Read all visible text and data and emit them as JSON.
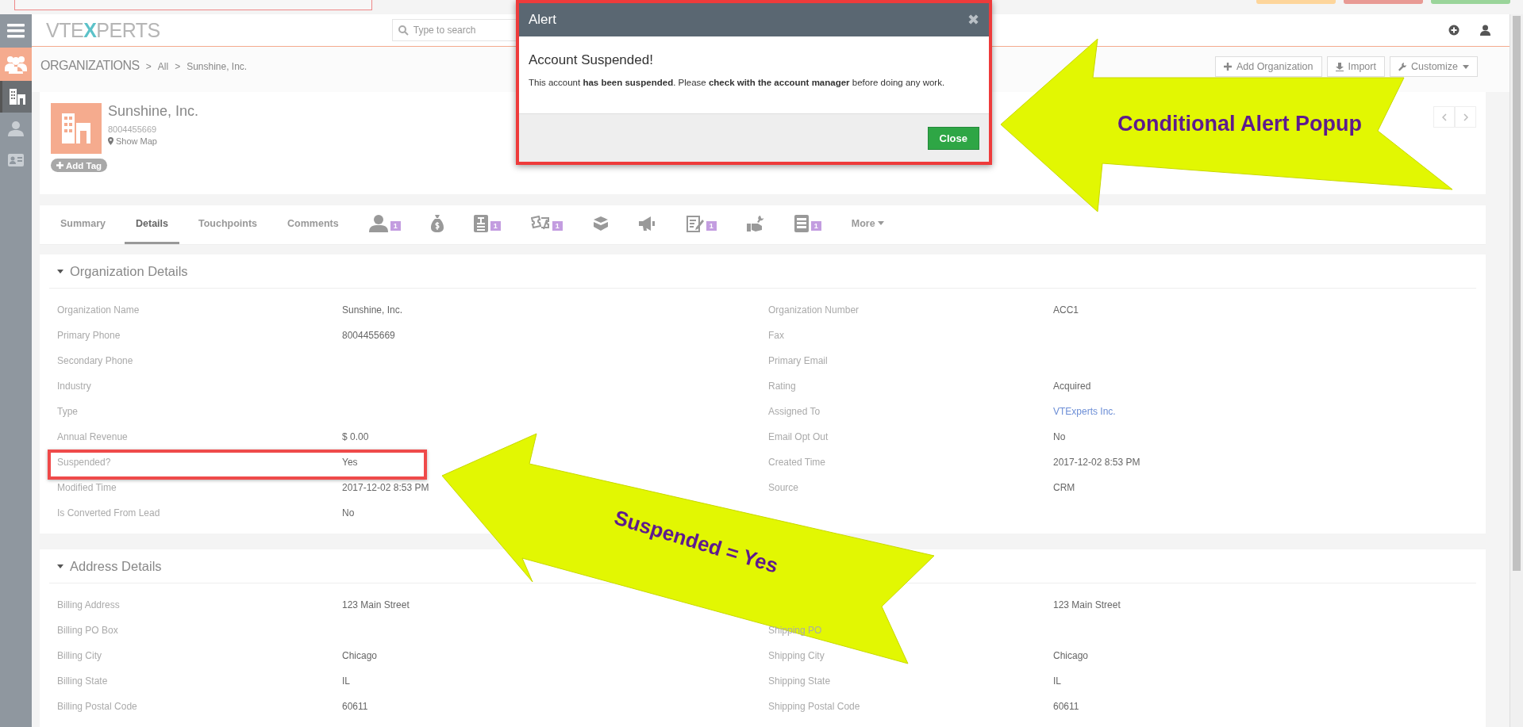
{
  "sidebar": {
    "items": [
      {
        "kind": "menu",
        "selected": false
      },
      {
        "kind": "group",
        "selected": false
      },
      {
        "kind": "building",
        "selected": true
      },
      {
        "kind": "person",
        "selected": false
      },
      {
        "kind": "card",
        "selected": false
      }
    ]
  },
  "header": {
    "logo_parts": [
      "VTE",
      "X",
      "PERTS"
    ],
    "search": {
      "placeholder": "Type to search"
    }
  },
  "breadcrumb": {
    "module": "ORGANIZATIONS",
    "items": [
      "All",
      "Sunshine, Inc."
    ],
    "separator": ">"
  },
  "actions": [
    {
      "kind": "plus",
      "label": "Add Organization"
    },
    {
      "kind": "download",
      "label": "Import"
    },
    {
      "kind": "wrench",
      "label": "Customize",
      "caret": true
    }
  ],
  "record": {
    "name": "Sunshine, Inc.",
    "phone": "8004455669",
    "map_link": "Show Map",
    "add_tag": "Add Tag"
  },
  "tabs": [
    {
      "kind": "text",
      "label": "Summary",
      "selected": false
    },
    {
      "kind": "text",
      "label": "Details",
      "selected": true
    },
    {
      "kind": "text",
      "label": "Touchpoints",
      "selected": false
    },
    {
      "kind": "text",
      "label": "Comments",
      "selected": false
    },
    {
      "kind": "contact",
      "count": "1",
      "selected": false
    },
    {
      "kind": "money",
      "selected": false
    },
    {
      "kind": "card",
      "count": "1",
      "selected": false
    },
    {
      "kind": "ticket",
      "count": "1",
      "selected": false
    },
    {
      "kind": "box",
      "selected": false
    },
    {
      "kind": "megaphone",
      "selected": false
    },
    {
      "kind": "note",
      "count": "1",
      "selected": false
    },
    {
      "kind": "service",
      "selected": false
    },
    {
      "kind": "invoice",
      "count": "1",
      "selected": false
    },
    {
      "kind": "more",
      "label": "More",
      "selected": false
    }
  ],
  "sections": [
    {
      "title": "Organization Details",
      "rows": [
        {
          "left": {
            "label": "Organization Name",
            "value": "Sunshine, Inc.",
            "highlighted": false
          },
          "right": {
            "label": "Organization Number",
            "value": "ACC1",
            "link": false
          }
        },
        {
          "left": {
            "label": "Primary Phone",
            "value": "8004455669",
            "highlighted": false
          },
          "right": {
            "label": "Fax"
          }
        },
        {
          "left": {
            "label": "Secondary Phone",
            "highlighted": false
          },
          "right": {
            "label": "Primary Email"
          }
        },
        {
          "left": {
            "label": "Industry",
            "highlighted": false
          },
          "right": {
            "label": "Rating",
            "value": "Acquired",
            "link": false
          }
        },
        {
          "left": {
            "label": "Type",
            "highlighted": false
          },
          "right": {
            "label": "Assigned To",
            "value": "VTExperts Inc.",
            "link": true
          }
        },
        {
          "left": {
            "label": "Annual Revenue",
            "value": "$ 0.00",
            "highlighted": false
          },
          "right": {
            "label": "Email Opt Out",
            "value": "No",
            "link": false
          }
        },
        {
          "left": {
            "label": "Suspended?",
            "value": "Yes",
            "highlighted": true
          },
          "right": {
            "label": "Created Time",
            "value": "2017-12-02 8:53 PM",
            "link": false
          }
        },
        {
          "left": {
            "label": "Modified Time",
            "value": "2017-12-02 8:53 PM",
            "highlighted": false
          },
          "right": {
            "label": "Source",
            "value": "CRM",
            "link": false
          }
        },
        {
          "left": {
            "label": "Is Converted From Lead",
            "value": "No",
            "highlighted": false
          }
        }
      ]
    },
    {
      "title": "Address Details",
      "rows": [
        {
          "left": {
            "label": "Billing Address",
            "value": "123 Main Street",
            "highlighted": false
          },
          "right": {
            "value": "123 Main Street",
            "link": false
          }
        },
        {
          "left": {
            "label": "Billing PO Box",
            "highlighted": false
          },
          "right": {
            "label": "Shipping PO"
          }
        },
        {
          "left": {
            "label": "Billing City",
            "value": "Chicago",
            "highlighted": false
          },
          "right": {
            "label": "Shipping City",
            "value": "Chicago",
            "link": false
          }
        },
        {
          "left": {
            "label": "Billing State",
            "value": "IL",
            "highlighted": false
          },
          "right": {
            "label": "Shipping State",
            "value": "IL",
            "link": false
          }
        },
        {
          "left": {
            "label": "Billing Postal Code",
            "value": "60611",
            "highlighted": false
          },
          "right": {
            "label": "Shipping Postal Code",
            "value": "60611",
            "link": false
          }
        }
      ]
    }
  ],
  "modal": {
    "title": "Alert",
    "close_icon": "✖",
    "heading": "Account Suspended!",
    "message": "This account **has been suspended**. Please **check with the account manager** before doing any work.",
    "button": "Close"
  },
  "annotations": [
    {
      "kind": "top",
      "text": "Conditional Alert Popup"
    },
    {
      "kind": "bottom",
      "text": "Suspended = Yes"
    }
  ]
}
